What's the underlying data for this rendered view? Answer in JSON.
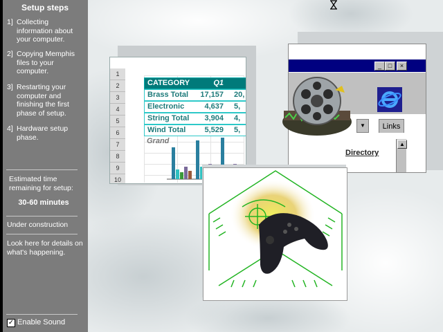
{
  "panel": {
    "title": "Setup steps",
    "steps": [
      {
        "num": "1]",
        "text": "Collecting information about your computer."
      },
      {
        "num": "2]",
        "text": "Copying Memphis files to your computer."
      },
      {
        "num": "3]",
        "text": "Restarting your computer and finishing the first phase of setup."
      },
      {
        "num": "4]",
        "text": "Hardware setup phase."
      }
    ],
    "estimate_label": "Estimated time remaining for setup:",
    "estimate_value": "30-60 minutes",
    "status": "Under construction",
    "hint": "Look here for details on what's happening.",
    "sound": {
      "label": "Enable Sound",
      "checked": true
    }
  },
  "spreadsheet": {
    "row_numbers": [
      "1",
      "2",
      "3",
      "4",
      "5",
      "6",
      "7",
      "8",
      "9",
      "10"
    ],
    "header": {
      "category": "CATEGORY",
      "q1": "Q1"
    },
    "rows": [
      {
        "category": "Brass Total",
        "q1": "17,157",
        "q2": "20,"
      },
      {
        "category": "Electronic",
        "q1": "4,637",
        "q2": "5,"
      },
      {
        "category": "String Total",
        "q1": "3,904",
        "q2": "4,"
      },
      {
        "category": "Wind Total",
        "q1": "5,529",
        "q2": "5,"
      }
    ],
    "grand_label": "Grand",
    "colors": {
      "header_bg": "#007a7a",
      "border": "#2cc8c8",
      "text": "#1e7a7a"
    }
  },
  "browser": {
    "buttons": {
      "minimize": "_",
      "maximize": "□",
      "close": "×"
    },
    "links_label": "Links",
    "directory_label": "Directory",
    "colors": {
      "titlebar": "#000080",
      "chrome": "#c0c0c0"
    }
  },
  "icons": {
    "film": "film-reel-icon",
    "ie": "internet-explorer-icon",
    "gamepad": "gamepad-icon",
    "cursor": "hourglass-icon"
  }
}
